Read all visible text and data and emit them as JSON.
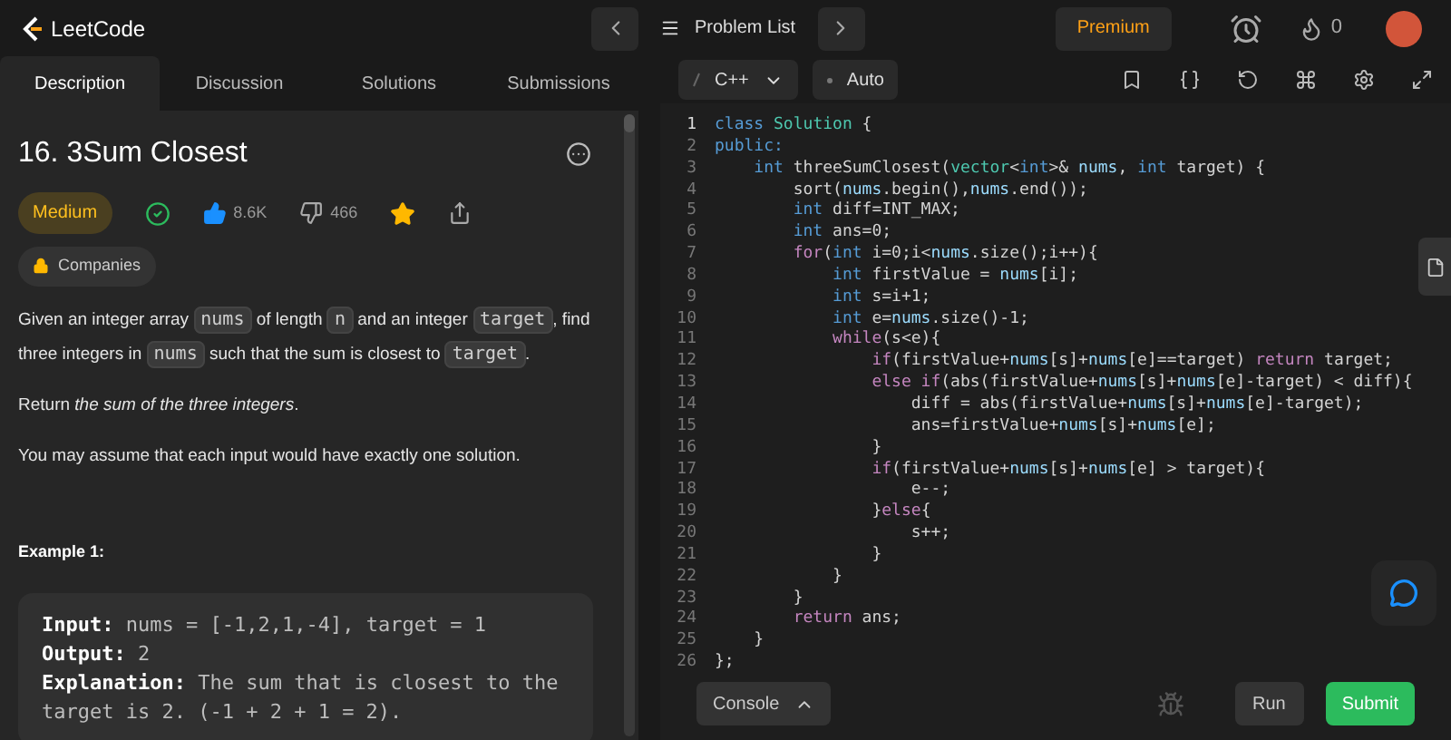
{
  "topbar": {
    "logo": "LeetCode",
    "problem_list": "Problem List",
    "premium": "Premium",
    "streak": "0"
  },
  "tabs": [
    {
      "label": "Description",
      "selected": true
    },
    {
      "label": "Discussion",
      "selected": false
    },
    {
      "label": "Solutions",
      "selected": false
    },
    {
      "label": "Submissions",
      "selected": false
    }
  ],
  "problem": {
    "title": "16. 3Sum Closest",
    "difficulty": "Medium",
    "solved": true,
    "likes": "8.6K",
    "dislikes": "466",
    "favorited": true,
    "companies": "Companies",
    "paragraphs": [
      [
        {
          "kind": "text",
          "text": "Given an integer array "
        },
        {
          "kind": "code",
          "text": "nums"
        },
        {
          "kind": "text",
          "text": " of length "
        },
        {
          "kind": "code",
          "text": "n"
        },
        {
          "kind": "text",
          "text": " and an integer "
        },
        {
          "kind": "code",
          "text": "target"
        },
        {
          "kind": "text",
          "text": ", find three integers in "
        },
        {
          "kind": "code",
          "text": "nums"
        },
        {
          "kind": "text",
          "text": " such that the sum is closest to "
        },
        {
          "kind": "code",
          "text": "target"
        },
        {
          "kind": "text",
          "text": "."
        }
      ],
      [
        {
          "kind": "text",
          "text": "Return "
        },
        {
          "kind": "italic",
          "text": "the sum of the three integers"
        },
        {
          "kind": "text",
          "text": "."
        }
      ],
      [
        {
          "kind": "text",
          "text": "You may assume that each input would have exactly one solution."
        }
      ]
    ],
    "example_title": "Example 1:",
    "example": [
      {
        "label": "Input:",
        "value": "nums = [-1,2,1,-4], target = 1"
      },
      {
        "label": "Output:",
        "value": "2"
      },
      {
        "label": "Explanation:",
        "value": "The sum that is closest to the target is 2. (-1 + 2 + 1 = 2)."
      }
    ]
  },
  "editor": {
    "language": "C++",
    "mode": "Auto",
    "lines": [
      {
        "number": "1",
        "tokens": [
          {
            "text": "class ",
            "kind": "kw"
          },
          {
            "text": "Solution",
            "kind": "type"
          },
          {
            "text": " {",
            "kind": "p"
          }
        ]
      },
      {
        "number": "2",
        "tokens": [
          {
            "text": "public:",
            "kind": "kw"
          }
        ]
      },
      {
        "number": "3",
        "tokens": [
          {
            "text": "    int ",
            "kind": "kw"
          },
          {
            "text": "threeSumClosest(",
            "kind": "p"
          },
          {
            "text": "vector",
            "kind": "type"
          },
          {
            "text": "<",
            "kind": "p"
          },
          {
            "text": "int",
            "kind": "kw"
          },
          {
            "text": ">& ",
            "kind": "p"
          },
          {
            "text": "nums",
            "kind": "var"
          },
          {
            "text": ", ",
            "kind": "p"
          },
          {
            "text": "int ",
            "kind": "kw"
          },
          {
            "text": "target) {",
            "kind": "p"
          }
        ]
      },
      {
        "number": "4",
        "tokens": [
          {
            "text": "        sort(",
            "kind": "p"
          },
          {
            "text": "nums",
            "kind": "var"
          },
          {
            "text": ".begin(),",
            "kind": "p"
          },
          {
            "text": "nums",
            "kind": "var"
          },
          {
            "text": ".end());",
            "kind": "p"
          }
        ]
      },
      {
        "number": "5",
        "tokens": [
          {
            "text": "        int ",
            "kind": "kw"
          },
          {
            "text": "diff=INT_MAX;",
            "kind": "p"
          }
        ]
      },
      {
        "number": "6",
        "tokens": [
          {
            "text": "        int ",
            "kind": "kw"
          },
          {
            "text": "ans=0;",
            "kind": "p"
          }
        ]
      },
      {
        "number": "7",
        "tokens": [
          {
            "text": "        for",
            "kind": "ctl"
          },
          {
            "text": "(",
            "kind": "p"
          },
          {
            "text": "int ",
            "kind": "kw"
          },
          {
            "text": "i=0;i<",
            "kind": "p"
          },
          {
            "text": "nums",
            "kind": "var"
          },
          {
            "text": ".size();i++){",
            "kind": "p"
          }
        ]
      },
      {
        "number": "8",
        "tokens": [
          {
            "text": "            int ",
            "kind": "kw"
          },
          {
            "text": "firstValue = ",
            "kind": "p"
          },
          {
            "text": "nums",
            "kind": "var"
          },
          {
            "text": "[i];",
            "kind": "p"
          }
        ]
      },
      {
        "number": "9",
        "tokens": [
          {
            "text": "            int ",
            "kind": "kw"
          },
          {
            "text": "s=i+1;",
            "kind": "p"
          }
        ]
      },
      {
        "number": "10",
        "tokens": [
          {
            "text": "            int ",
            "kind": "kw"
          },
          {
            "text": "e=",
            "kind": "p"
          },
          {
            "text": "nums",
            "kind": "var"
          },
          {
            "text": ".size()-1;",
            "kind": "p"
          }
        ]
      },
      {
        "number": "11",
        "tokens": [
          {
            "text": "            while",
            "kind": "ctl"
          },
          {
            "text": "(s<e){",
            "kind": "p"
          }
        ]
      },
      {
        "number": "12",
        "tokens": [
          {
            "text": "                if",
            "kind": "ctl"
          },
          {
            "text": "(firstValue+",
            "kind": "p"
          },
          {
            "text": "nums",
            "kind": "var"
          },
          {
            "text": "[s]+",
            "kind": "p"
          },
          {
            "text": "nums",
            "kind": "var"
          },
          {
            "text": "[e]==target) ",
            "kind": "p"
          },
          {
            "text": "return",
            "kind": "ctl"
          },
          {
            "text": " target;",
            "kind": "p"
          }
        ]
      },
      {
        "number": "13",
        "tokens": [
          {
            "text": "                else if",
            "kind": "ctl"
          },
          {
            "text": "(abs(firstValue+",
            "kind": "p"
          },
          {
            "text": "nums",
            "kind": "var"
          },
          {
            "text": "[s]+",
            "kind": "p"
          },
          {
            "text": "nums",
            "kind": "var"
          },
          {
            "text": "[e]-target) < diff){",
            "kind": "p"
          }
        ]
      },
      {
        "number": "14",
        "tokens": [
          {
            "text": "                    diff = abs(firstValue+",
            "kind": "p"
          },
          {
            "text": "nums",
            "kind": "var"
          },
          {
            "text": "[s]+",
            "kind": "p"
          },
          {
            "text": "nums",
            "kind": "var"
          },
          {
            "text": "[e]-target);",
            "kind": "p"
          }
        ]
      },
      {
        "number": "15",
        "tokens": [
          {
            "text": "                    ans=firstValue+",
            "kind": "p"
          },
          {
            "text": "nums",
            "kind": "var"
          },
          {
            "text": "[s]+",
            "kind": "p"
          },
          {
            "text": "nums",
            "kind": "var"
          },
          {
            "text": "[e];",
            "kind": "p"
          }
        ]
      },
      {
        "number": "16",
        "tokens": [
          {
            "text": "                }",
            "kind": "p"
          }
        ]
      },
      {
        "number": "17",
        "tokens": [
          {
            "text": "                if",
            "kind": "ctl"
          },
          {
            "text": "(firstValue+",
            "kind": "p"
          },
          {
            "text": "nums",
            "kind": "var"
          },
          {
            "text": "[s]+",
            "kind": "p"
          },
          {
            "text": "nums",
            "kind": "var"
          },
          {
            "text": "[e] > target){",
            "kind": "p"
          }
        ]
      },
      {
        "number": "18",
        "tokens": [
          {
            "text": "                    e--;",
            "kind": "p"
          }
        ]
      },
      {
        "number": "19",
        "tokens": [
          {
            "text": "                }",
            "kind": "p"
          },
          {
            "text": "else",
            "kind": "ctl"
          },
          {
            "text": "{",
            "kind": "p"
          }
        ]
      },
      {
        "number": "20",
        "tokens": [
          {
            "text": "                    s++;",
            "kind": "p"
          }
        ]
      },
      {
        "number": "21",
        "tokens": [
          {
            "text": "                }",
            "kind": "p"
          }
        ]
      },
      {
        "number": "22",
        "tokens": [
          {
            "text": "            }",
            "kind": "p"
          }
        ]
      },
      {
        "number": "23",
        "tokens": [
          {
            "text": "        }",
            "kind": "p"
          }
        ]
      },
      {
        "number": "24",
        "tokens": [
          {
            "text": "        return",
            "kind": "ctl"
          },
          {
            "text": " ans;",
            "kind": "p"
          }
        ]
      },
      {
        "number": "25",
        "tokens": [
          {
            "text": "    }",
            "kind": "p"
          }
        ]
      },
      {
        "number": "26",
        "tokens": [
          {
            "text": "};",
            "kind": "p"
          }
        ]
      }
    ],
    "console": "Console",
    "run": "Run",
    "submit": "Submit"
  }
}
